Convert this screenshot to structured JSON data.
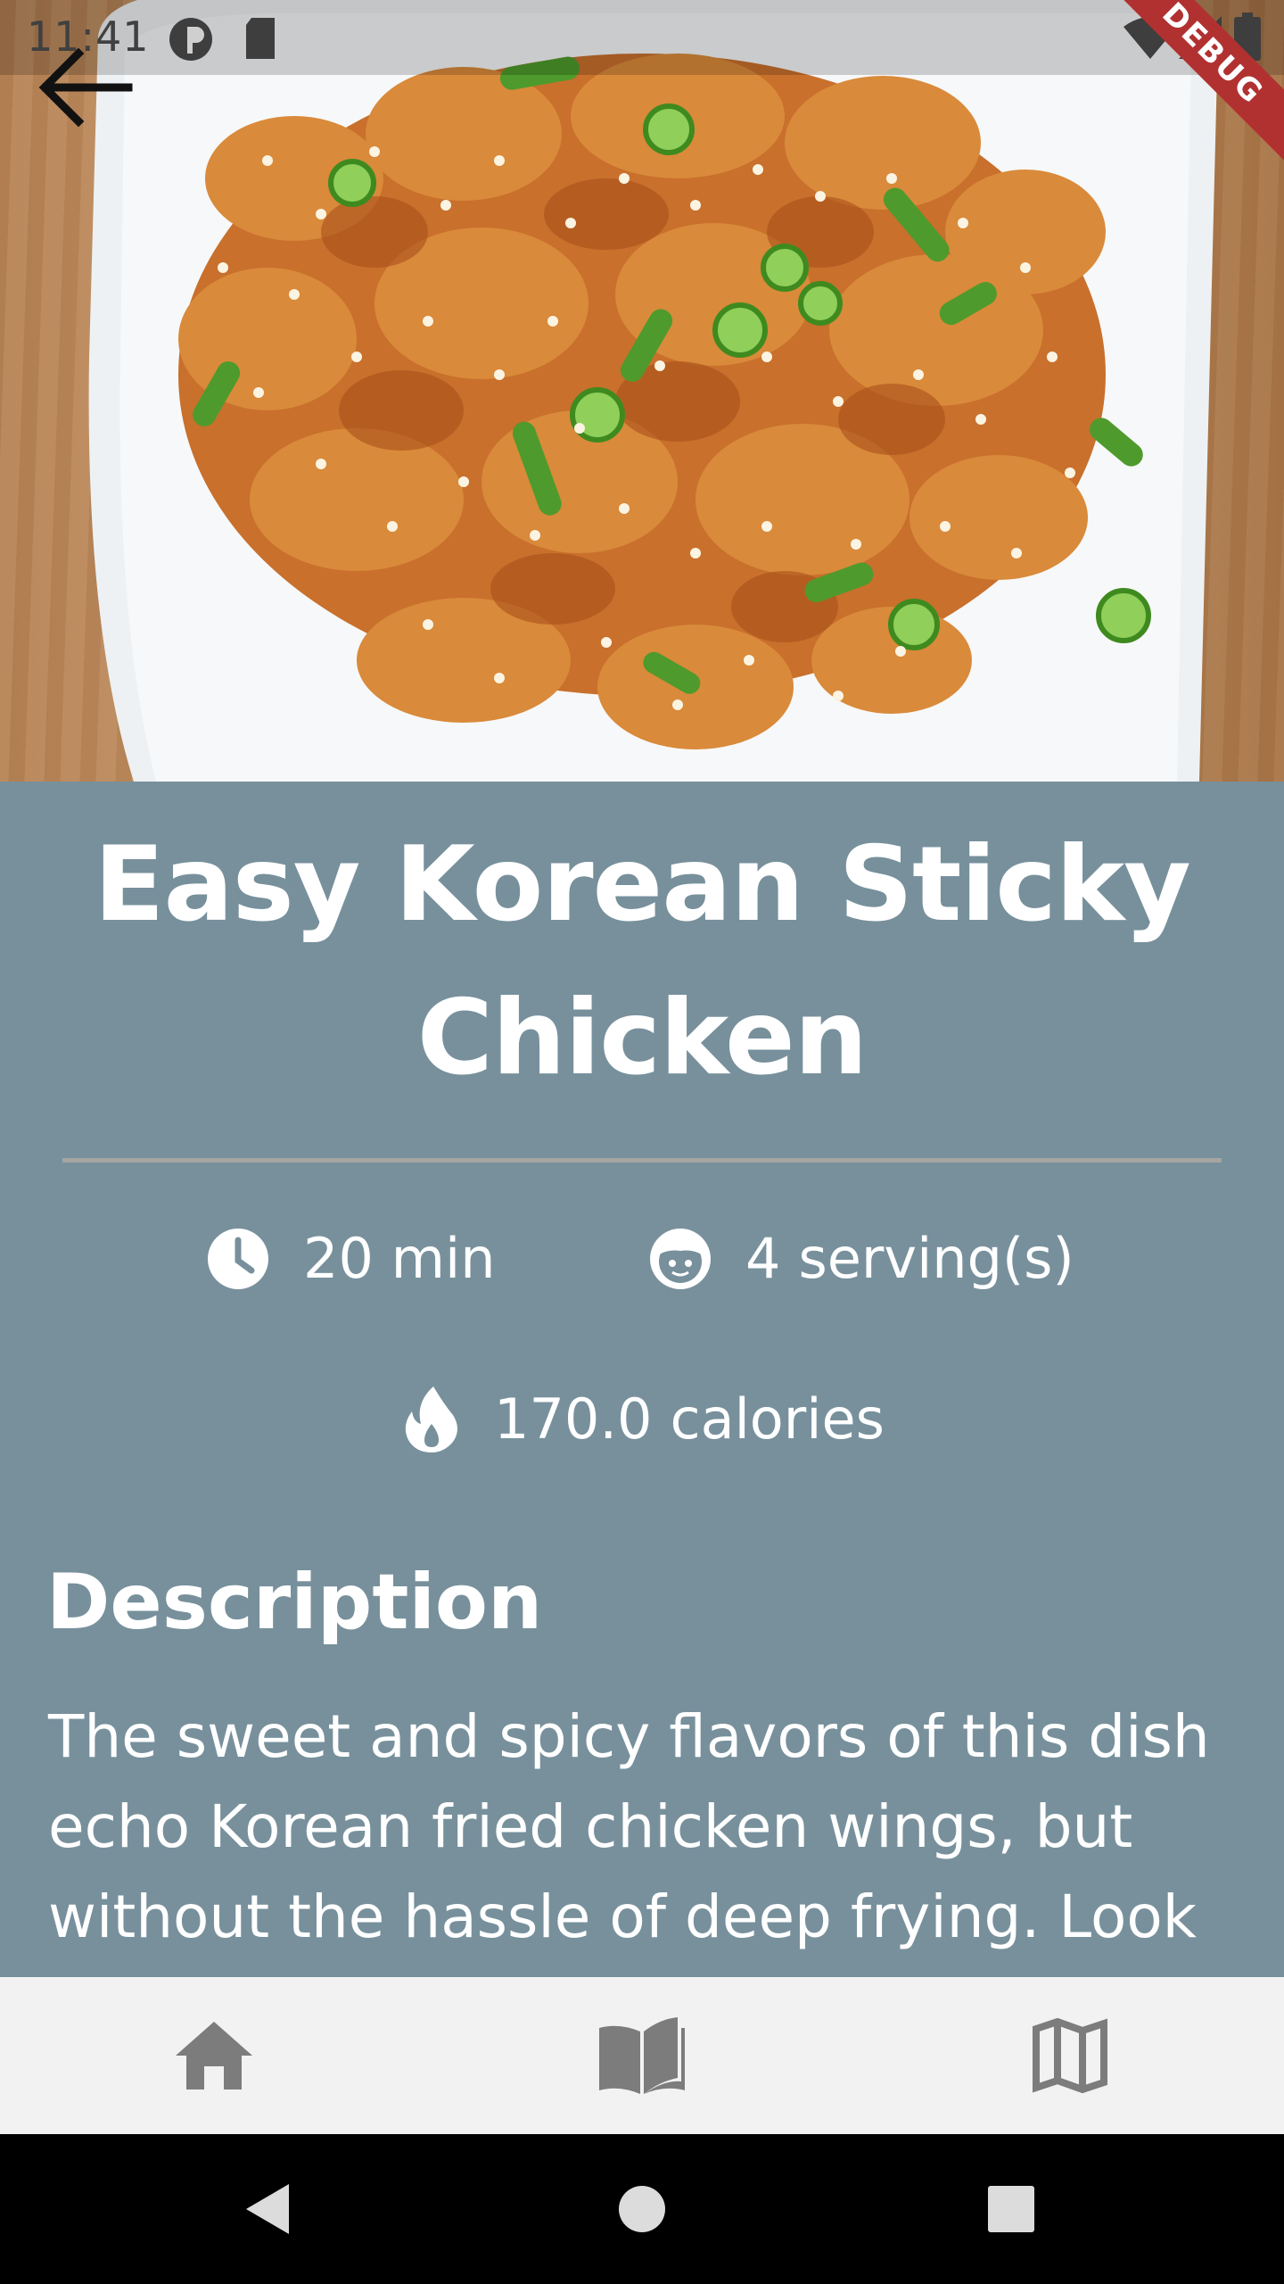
{
  "status_bar": {
    "time": "11:41",
    "debug_label": "DEBUG"
  },
  "recipe": {
    "title": "Easy Korean Sticky Chicken",
    "time": "20 min",
    "servings_count": "4",
    "servings_label": "serving(s)",
    "calories_value": "170.0",
    "calories_label": "calories",
    "description_heading": "Description",
    "description": "The sweet and spicy flavors of this dish echo Korean fried chicken wings, but without the hassle of deep frying. Look"
  },
  "icons": {
    "back": "arrow-left-icon",
    "time": "clock-icon",
    "servings": "face-icon",
    "calories": "fire-icon",
    "nav_home": "home-icon",
    "nav_recipes": "book-icon",
    "nav_map": "map-icon"
  },
  "colors": {
    "content_background": "#77909c",
    "nav_background": "#f2f2f2",
    "nav_icon": "#7c7c7c",
    "debug_banner": "#b13131"
  }
}
